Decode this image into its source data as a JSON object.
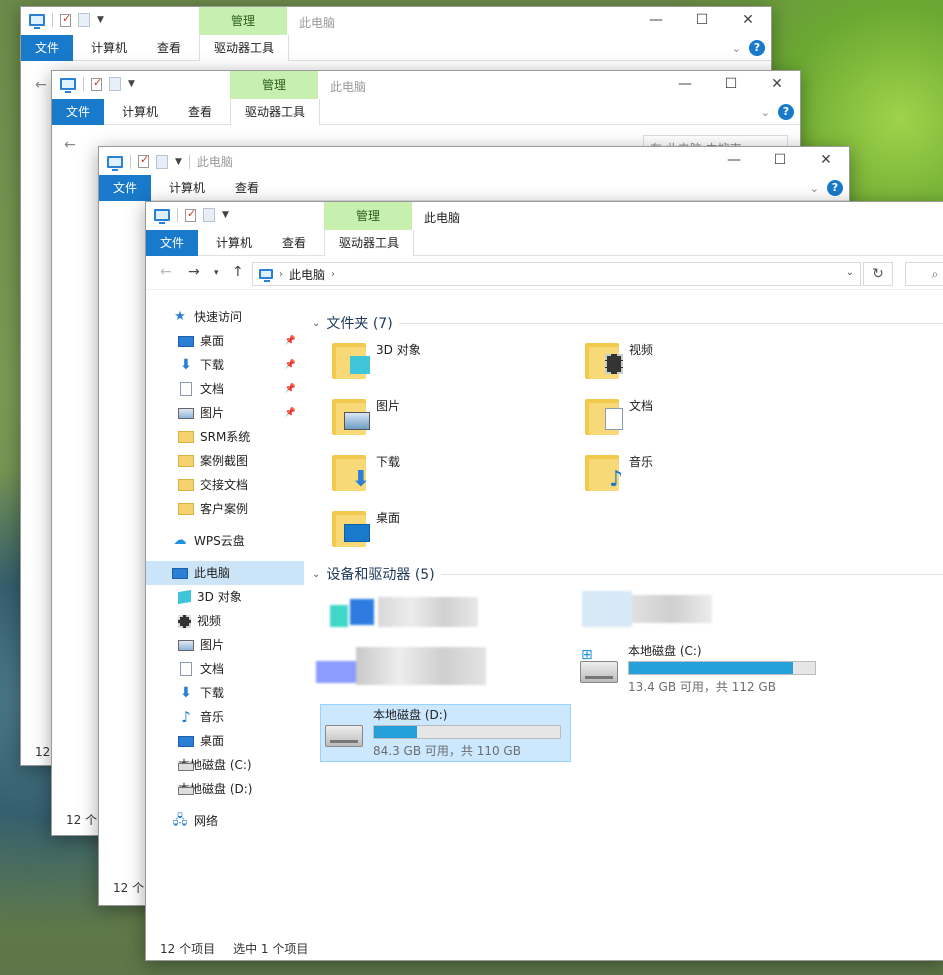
{
  "window": {
    "title": "此电脑",
    "manage_tab": "管理",
    "ribbon_tabs": {
      "file": "文件",
      "computer": "计算机",
      "view": "查看",
      "drive_tools": "驱动器工具"
    },
    "controls": {
      "minimize": "—",
      "maximize": "☐",
      "close": "✕"
    },
    "help": "?"
  },
  "back_windows": {
    "search_placeholder": "在 此电脑 中搜索",
    "status_count_1": "12",
    "status_count_2": "12 个",
    "status_count_3": "12 个"
  },
  "address": {
    "root": "此电脑"
  },
  "sidebar": {
    "quick_access": "快速访问",
    "items": [
      {
        "label": "桌面",
        "icon": "desktop-icon",
        "pinned": true
      },
      {
        "label": "下载",
        "icon": "download-icon",
        "pinned": true
      },
      {
        "label": "文档",
        "icon": "document-icon",
        "pinned": true
      },
      {
        "label": "图片",
        "icon": "pictures-icon",
        "pinned": true
      },
      {
        "label": "SRM系统",
        "icon": "folder-icon"
      },
      {
        "label": "案例截图",
        "icon": "folder-icon"
      },
      {
        "label": "交接文档",
        "icon": "folder-icon"
      },
      {
        "label": "客户案例",
        "icon": "folder-icon"
      }
    ],
    "wps_cloud": "WPS云盘",
    "this_pc": "此电脑",
    "pc_items": [
      {
        "label": "3D 对象",
        "icon": "3d-objects-icon"
      },
      {
        "label": "视频",
        "icon": "video-icon"
      },
      {
        "label": "图片",
        "icon": "pictures-icon"
      },
      {
        "label": "文档",
        "icon": "document-icon"
      },
      {
        "label": "下载",
        "icon": "download-icon"
      },
      {
        "label": "音乐",
        "icon": "music-icon"
      },
      {
        "label": "桌面",
        "icon": "desktop-icon"
      },
      {
        "label": "本地磁盘 (C:)",
        "icon": "drive-c-icon"
      },
      {
        "label": "本地磁盘 (D:)",
        "icon": "drive-d-icon"
      }
    ],
    "network": "网络"
  },
  "folders_section": {
    "title": "文件夹 (7)",
    "items": [
      {
        "label": "3D 对象",
        "icon": "3d-objects-folder-icon"
      },
      {
        "label": "视频",
        "icon": "video-folder-icon"
      },
      {
        "label": "图片",
        "icon": "pictures-folder-icon"
      },
      {
        "label": "文档",
        "icon": "documents-folder-icon"
      },
      {
        "label": "下载",
        "icon": "downloads-folder-icon"
      },
      {
        "label": "音乐",
        "icon": "music-folder-icon"
      },
      {
        "label": "桌面",
        "icon": "desktop-folder-icon"
      }
    ]
  },
  "devices_section": {
    "title": "设备和驱动器 (5)",
    "drives": [
      {
        "name": "本地磁盘 (C:)",
        "free_text": "13.4 GB 可用，共 112 GB",
        "used_fraction": 0.88
      },
      {
        "name": "本地磁盘 (D:)",
        "free_text": "84.3 GB 可用，共 110 GB",
        "used_fraction": 0.23
      }
    ]
  },
  "status": {
    "count": "12 个项目",
    "selected": "选中 1 个项目"
  },
  "colors": {
    "accent": "#1979ca",
    "manage_bg": "#c6efb0",
    "selection": "#cce8ff",
    "drive_bar": "#26a0da"
  }
}
